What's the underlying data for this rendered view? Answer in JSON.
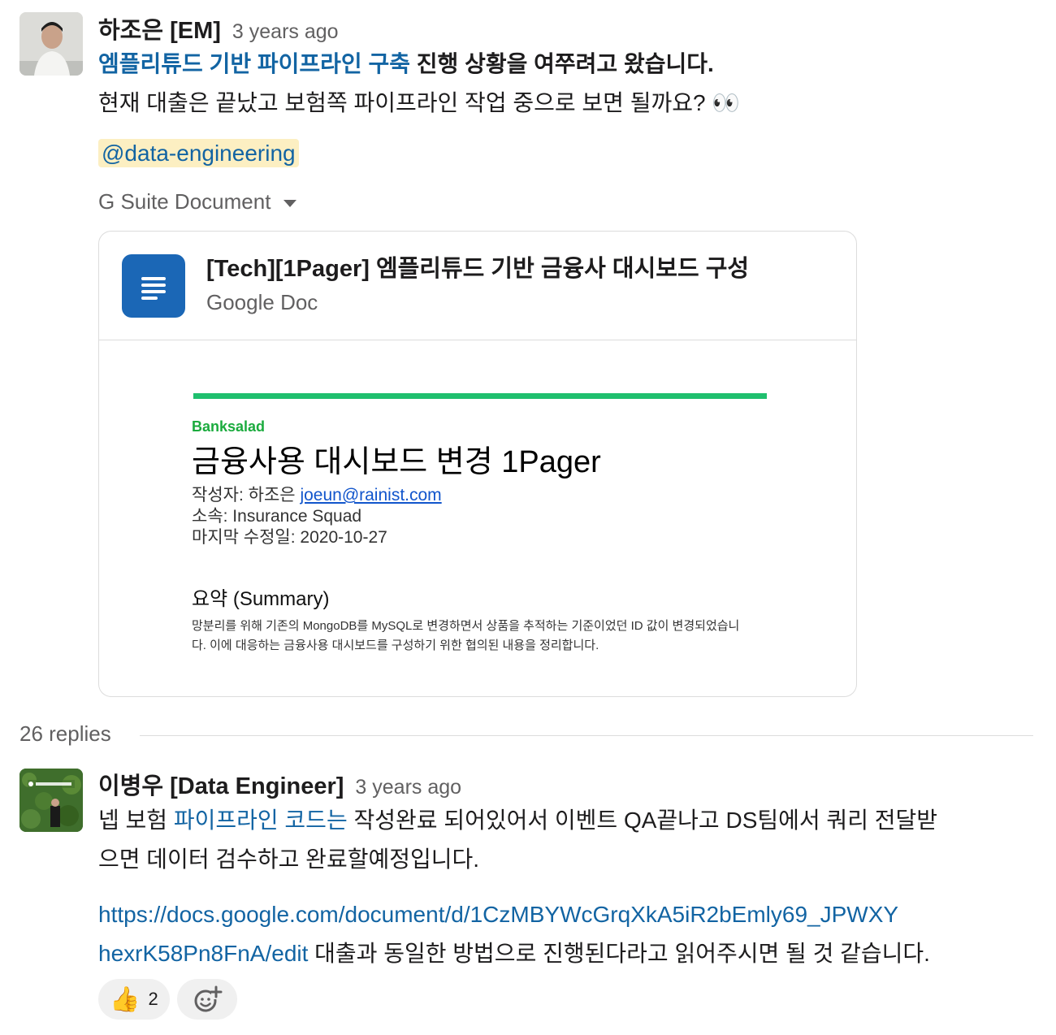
{
  "message1": {
    "author": "하조은 [EM]",
    "time": "3 years ago",
    "line1_link": "엠플리튜드 기반 파이프라인 구축",
    "line1_rest": " 진행 상황을 여쭈려고 왔습니다.",
    "line2": "현재 대출은 끝났고 보험쪽 파이프라인 작업 중으로 보면 될까요? 👀",
    "mention": "@data-engineering"
  },
  "attachment": {
    "source_label": "G Suite Document",
    "title": "[Tech][1Pager] 엠플리튜드 기반 금융사 대시보드 구성",
    "subtitle": "Google Doc",
    "preview": {
      "brand": "Banksalad",
      "heading": "금융사용 대시보드 변경 1Pager",
      "author_label": "작성자: 하조은 ",
      "author_email": "joeun@rainist.com",
      "team": "소속: Insurance Squad",
      "last_modified": "마지막 수정일: 2020-10-27",
      "summary_heading": "요약 (Summary)",
      "summary_text": "망분리를 위해 기존의 MongoDB를 MySQL로 변경하면서 상품을 추적하는 기준이었던 ID 값이 변경되었습니다. 이에 대응하는 금융사용 대시보드를 구성하기 위한 협의된 내용을 정리합니다."
    }
  },
  "thread": {
    "replies_label": "26 replies"
  },
  "message2": {
    "author": "이병우 [Data Engineer]",
    "time": "3 years ago",
    "p1_a": "넵 보험 ",
    "p1_link": "파이프라인 코드는",
    "p1_b": " 작성완료 되어있어서 이벤트 QA끝나고 DS팀에서 쿼리 전달받",
    "p1_c": "으면 데이터 검수하고 완료할예정입니다.",
    "p2_url_1": "https://docs.google.com/document/d/1CzMBYWcGrqXkA5iR2bEmly69_JPWXY",
    "p2_url_2": "hexrK58Pn8FnA/edit",
    "p2_rest": " 대출과 동일한 방법으로 진행된다라고 읽어주시면 될 것 같습니다."
  },
  "reactions": [
    {
      "emoji": "👍",
      "count": "2"
    }
  ],
  "icons": {
    "thumbs_up": "thumbs-up-icon",
    "add_reaction": "add-reaction-icon",
    "doc": "google-doc-icon"
  }
}
